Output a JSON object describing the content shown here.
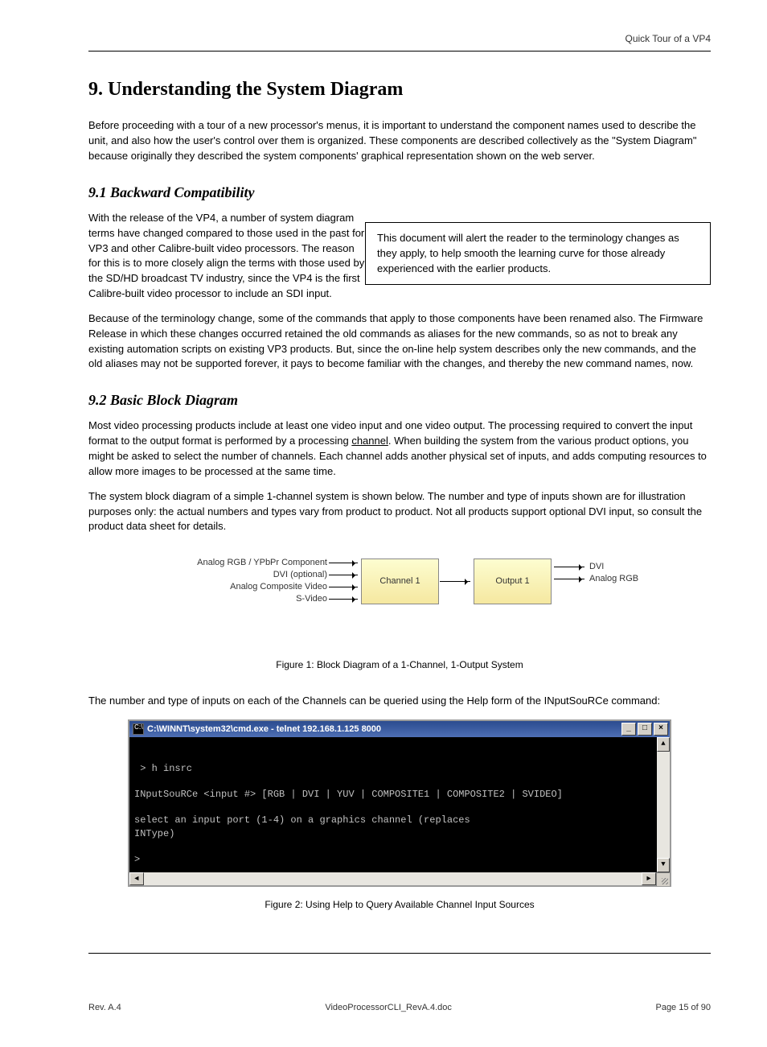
{
  "page_header": "Quick Tour of a VP4",
  "title": "9. Understanding the System Diagram",
  "intro": "Before proceeding with a tour of a new processor's menus, it is important to understand the component names used to describe the unit, and also how the user's control over them is organized. These components are described collectively as the \"System Diagram\" because originally they described the system components' graphical representation shown on the web server.",
  "backcompat": {
    "heading": "9.1 Backward Compatibility",
    "p1_a": "With the release of the VP4, a number of system diagram terms have changed compared to those used in the past for VP3 and other Calibre-built video processors. The reason for this is to more closely align the terms with those used by the SD/HD broadcast TV industry, since the ",
    "p1_b": "VP4 is the first Calibre-built video processor to include an SDI input.",
    "callout": "This document will alert the reader to the terminology changes as they apply, to help smooth the learning curve for those already experienced with the earlier products.",
    "p2": "Because of the terminology change, some of the commands that apply to those components have been renamed also. The Firmware Release in which these changes occurred retained the old commands as aliases for the new commands, so as not to break any existing automation scripts on existing VP3 products. But, since the on-line help system describes only the new commands, and the old aliases may not be supported forever, it pays to become familiar with the changes, and thereby the new command names, now."
  },
  "block": {
    "heading": "9.2 Basic Block Diagram",
    "p1_a": "Most video processing products include at least one video input and one video output. The processing required to convert the input format to the output format is performed by a processing ",
    "p1_b": "channel",
    "p1_c": ". When building the system from the various product options, you might be asked to select the number of channels. Each channel adds another physical set of inputs, and adds computing resources to allow more images to be processed at the same time.",
    "p2": "The system block diagram of a simple 1-channel system is shown below. The number and type of inputs shown are for illustration purposes only: the actual numbers and types vary from product to product. Not all products support optional DVI input, so consult the product data sheet for details.",
    "diagram": {
      "inputs": [
        "Analog RGB / YPbPr Component",
        "DVI (optional)",
        "Analog Composite Video",
        "S-Video"
      ],
      "channel_label": "Channel 1",
      "output_label": "Output 1",
      "outputs": [
        "DVI",
        "Analog RGB"
      ]
    },
    "caption": "Figure 1: Block Diagram of a 1-Channel, 1-Output System",
    "p3": "The number and type of inputs on each of the Channels can be queried using the Help form of the INputSouRCe command:",
    "cmd_title": "C:\\WINNT\\system32\\cmd.exe - telnet 192.168.1.125 8000",
    "cmd_body": "\n > h insrc\n\nINputSouRCe <input #> [RGB | DVI | YUV | COMPOSITE1 | COMPOSITE2 | SVIDEO]\n\nselect an input port (1-4) on a graphics channel (replaces\nINType)\n\n>",
    "caption2": "Figure 2: Using Help to Query Available Channel Input Sources"
  },
  "footer": {
    "left": "Rev. A.4",
    "center": "VideoProcessorCLI_RevA.4.doc",
    "right": "Page 15 of 90"
  }
}
